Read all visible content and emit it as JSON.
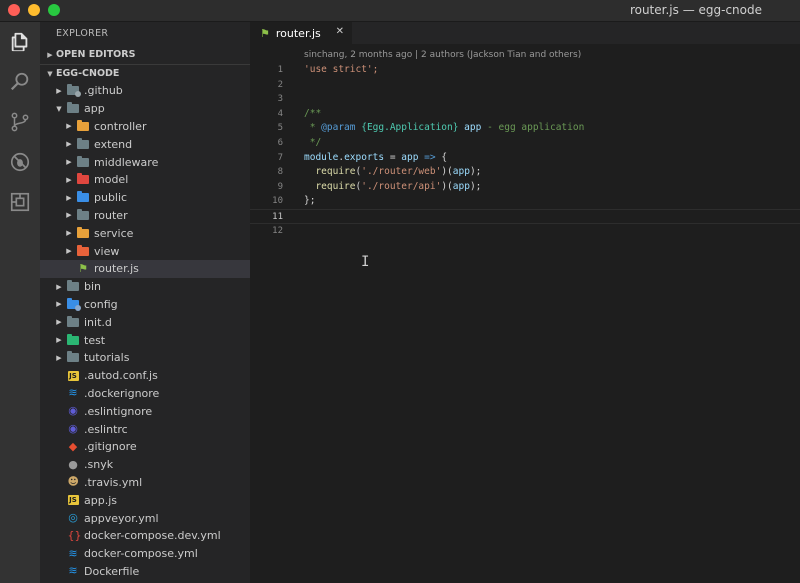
{
  "window": {
    "title": "router.js — egg-cnode"
  },
  "activity_bar": [
    {
      "name": "explorer-icon",
      "active": true
    },
    {
      "name": "search-icon",
      "active": false
    },
    {
      "name": "source-control-icon",
      "active": false
    },
    {
      "name": "debug-icon",
      "active": false
    },
    {
      "name": "extensions-icon",
      "active": false
    }
  ],
  "explorer": {
    "header": "EXPLORER",
    "open_editors": "OPEN EDITORS",
    "project": "EGG-CNODE",
    "items": [
      {
        "label": ".github",
        "type": "folder",
        "depth": 0,
        "color": "#6d8086",
        "badge": "#9aa6ab",
        "open": false
      },
      {
        "label": "app",
        "type": "folder",
        "depth": 0,
        "color": "#6d8086",
        "badge": "",
        "open": true
      },
      {
        "label": "controller",
        "type": "folder",
        "depth": 1,
        "color": "#e8a13a",
        "badge": "",
        "open": false
      },
      {
        "label": "extend",
        "type": "folder",
        "depth": 1,
        "color": "#6d8086",
        "badge": "",
        "open": false
      },
      {
        "label": "middleware",
        "type": "folder",
        "depth": 1,
        "color": "#6d8086",
        "badge": "",
        "open": false
      },
      {
        "label": "model",
        "type": "folder",
        "depth": 1,
        "color": "#e0473f",
        "badge": "",
        "open": false
      },
      {
        "label": "public",
        "type": "folder",
        "depth": 1,
        "color": "#3a8ee6",
        "badge": "",
        "open": false
      },
      {
        "label": "router",
        "type": "folder",
        "depth": 1,
        "color": "#6d8086",
        "badge": "",
        "open": false
      },
      {
        "label": "service",
        "type": "folder",
        "depth": 1,
        "color": "#e8a13a",
        "badge": "",
        "open": false
      },
      {
        "label": "view",
        "type": "folder",
        "depth": 1,
        "color": "#e8623a",
        "badge": "",
        "open": false
      },
      {
        "label": "router.js",
        "type": "file",
        "depth": 1,
        "icon": "router-icon",
        "icon_text": "⚑",
        "icon_color": "#8dc149",
        "icon_bg": "transparent",
        "selected": true
      },
      {
        "label": "bin",
        "type": "folder",
        "depth": 0,
        "color": "#6d8086",
        "badge": "",
        "open": false
      },
      {
        "label": "config",
        "type": "folder",
        "depth": 0,
        "color": "#3a8ee6",
        "badge": "#8aa8cc",
        "open": false
      },
      {
        "label": "init.d",
        "type": "folder",
        "depth": 0,
        "color": "#6d8086",
        "badge": "",
        "open": false
      },
      {
        "label": "test",
        "type": "folder",
        "depth": 0,
        "color": "#2bb673",
        "badge": "",
        "open": false
      },
      {
        "label": "tutorials",
        "type": "folder",
        "depth": 0,
        "color": "#6d8086",
        "badge": "",
        "open": false
      },
      {
        "label": ".autod.conf.js",
        "type": "file",
        "depth": 0,
        "icon": "javascript-icon",
        "icon_text": "JS",
        "icon_color": "#1e1e1e",
        "icon_bg": "#e8c53a"
      },
      {
        "label": ".dockerignore",
        "type": "file",
        "depth": 0,
        "icon": "docker-icon",
        "icon_text": "≋",
        "icon_color": "#2496ed",
        "icon_bg": "transparent"
      },
      {
        "label": ".eslintignore",
        "type": "file",
        "depth": 0,
        "icon": "eslint-icon",
        "icon_text": "◉",
        "icon_color": "#5f5cd6",
        "icon_bg": "transparent"
      },
      {
        "label": ".eslintrc",
        "type": "file",
        "depth": 0,
        "icon": "eslint-icon",
        "icon_text": "◉",
        "icon_color": "#5f5cd6",
        "icon_bg": "transparent"
      },
      {
        "label": ".gitignore",
        "type": "file",
        "depth": 0,
        "icon": "git-icon",
        "icon_text": "◆",
        "icon_color": "#e84e31",
        "icon_bg": "transparent"
      },
      {
        "label": ".snyk",
        "type": "file",
        "depth": 0,
        "icon": "snyk-icon",
        "icon_text": "●",
        "icon_color": "#9a9a9a",
        "icon_bg": "transparent"
      },
      {
        "label": ".travis.yml",
        "type": "file",
        "depth": 0,
        "icon": "travis-icon",
        "icon_text": "☻",
        "icon_color": "#cda869",
        "icon_bg": "transparent"
      },
      {
        "label": "app.js",
        "type": "file",
        "depth": 0,
        "icon": "javascript-icon",
        "icon_text": "JS",
        "icon_color": "#1e1e1e",
        "icon_bg": "#e8c53a"
      },
      {
        "label": "appveyor.yml",
        "type": "file",
        "depth": 0,
        "icon": "appveyor-icon",
        "icon_text": "◎",
        "icon_color": "#2aa4e0",
        "icon_bg": "transparent"
      },
      {
        "label": "docker-compose.dev.yml",
        "type": "file",
        "depth": 0,
        "icon": "yaml-icon",
        "icon_text": "{}",
        "icon_color": "#e0473f",
        "icon_bg": "transparent"
      },
      {
        "label": "docker-compose.yml",
        "type": "file",
        "depth": 0,
        "icon": "docker-icon",
        "icon_text": "≋",
        "icon_color": "#2496ed",
        "icon_bg": "transparent"
      },
      {
        "label": "Dockerfile",
        "type": "file",
        "depth": 0,
        "icon": "docker-icon",
        "icon_text": "≋",
        "icon_color": "#2496ed",
        "icon_bg": "transparent"
      }
    ]
  },
  "editor": {
    "tab_label": "router.js",
    "tab_icon": "⚑",
    "blame": "sinchang, 2 months ago | 2 authors (Jackson Tian and others)",
    "current_line": 11,
    "lines": [
      {
        "n": "1",
        "tokens": [
          {
            "t": "'use strict';",
            "c": "t-str"
          }
        ]
      },
      {
        "n": "2",
        "tokens": []
      },
      {
        "n": "3",
        "tokens": []
      },
      {
        "n": "4",
        "tokens": [
          {
            "t": "/**",
            "c": "t-com"
          }
        ]
      },
      {
        "n": "5",
        "tokens": [
          {
            "t": " * ",
            "c": "t-com"
          },
          {
            "t": "@param",
            "c": "t-kw"
          },
          {
            "t": " {Egg.Application} ",
            "c": "t-type"
          },
          {
            "t": "app",
            "c": "t-var"
          },
          {
            "t": " - egg application",
            "c": "t-com"
          }
        ]
      },
      {
        "n": "6",
        "tokens": [
          {
            "t": " */",
            "c": "t-com"
          }
        ]
      },
      {
        "n": "7",
        "tokens": [
          {
            "t": "module",
            "c": "t-var"
          },
          {
            "t": ".",
            "c": "t-def"
          },
          {
            "t": "exports",
            "c": "t-var"
          },
          {
            "t": " = ",
            "c": "t-def"
          },
          {
            "t": "app",
            "c": "t-var"
          },
          {
            "t": " => ",
            "c": "t-kw"
          },
          {
            "t": "{",
            "c": "t-def"
          }
        ]
      },
      {
        "n": "8",
        "tokens": [
          {
            "t": "  ",
            "c": "t-def"
          },
          {
            "t": "require",
            "c": "t-fn"
          },
          {
            "t": "(",
            "c": "t-def"
          },
          {
            "t": "'./router/web'",
            "c": "t-str"
          },
          {
            "t": ")(",
            "c": "t-def"
          },
          {
            "t": "app",
            "c": "t-var"
          },
          {
            "t": ");",
            "c": "t-def"
          }
        ]
      },
      {
        "n": "9",
        "tokens": [
          {
            "t": "  ",
            "c": "t-def"
          },
          {
            "t": "require",
            "c": "t-fn"
          },
          {
            "t": "(",
            "c": "t-def"
          },
          {
            "t": "'./router/api'",
            "c": "t-str"
          },
          {
            "t": ")(",
            "c": "t-def"
          },
          {
            "t": "app",
            "c": "t-var"
          },
          {
            "t": ");",
            "c": "t-def"
          }
        ]
      },
      {
        "n": "10",
        "tokens": [
          {
            "t": "};",
            "c": "t-def"
          }
        ]
      },
      {
        "n": "11",
        "tokens": []
      },
      {
        "n": "12",
        "tokens": []
      }
    ]
  }
}
